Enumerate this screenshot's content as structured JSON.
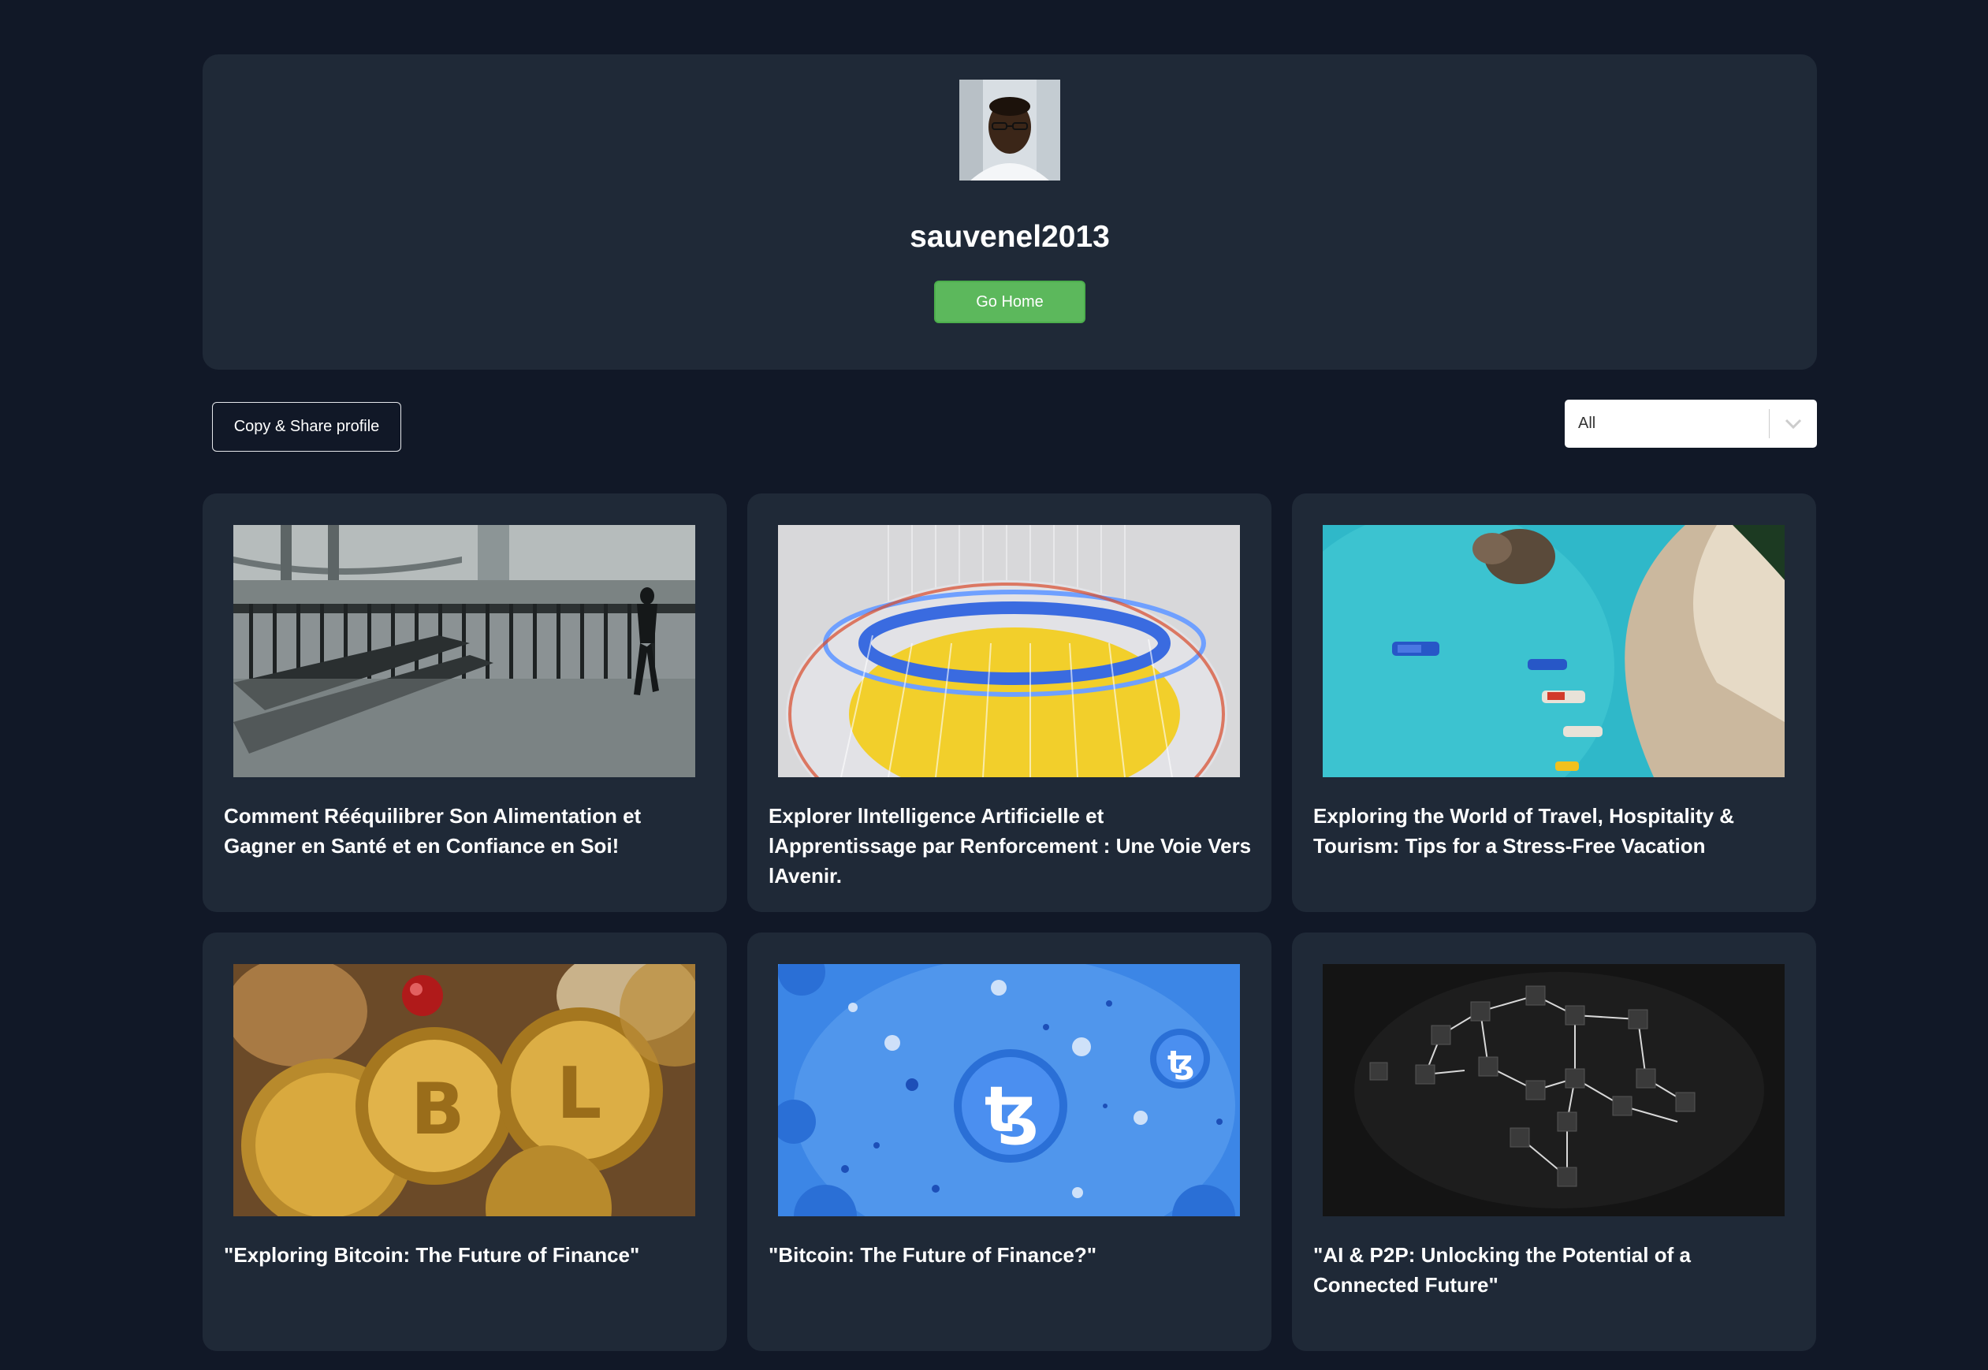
{
  "profile": {
    "username": "sauvenel2013",
    "go_home_label": "Go Home"
  },
  "toolbar": {
    "copy_share_label": "Copy & Share profile",
    "filter_selected": "All"
  },
  "posts": [
    {
      "title": "Comment Rééquilibrer Son Alimentation et Gagner en Santé et en Confiance en Soi!"
    },
    {
      "title": "Explorer lIntelligence Artificielle et lApprentissage par Renforcement : Une Voie Vers lAvenir."
    },
    {
      "title": "Exploring the World of Travel, Hospitality & Tourism: Tips for a Stress-Free Vacation"
    },
    {
      "title": "\"Exploring Bitcoin: The Future of Finance\""
    },
    {
      "title": "\"Bitcoin: The Future of Finance?\""
    },
    {
      "title": "\"AI & P2P: Unlocking the Potential of a Connected Future\""
    }
  ],
  "colors": {
    "page_bg": "#111827",
    "card_bg": "#1f2937",
    "go_home_green": "#5cb85c"
  }
}
